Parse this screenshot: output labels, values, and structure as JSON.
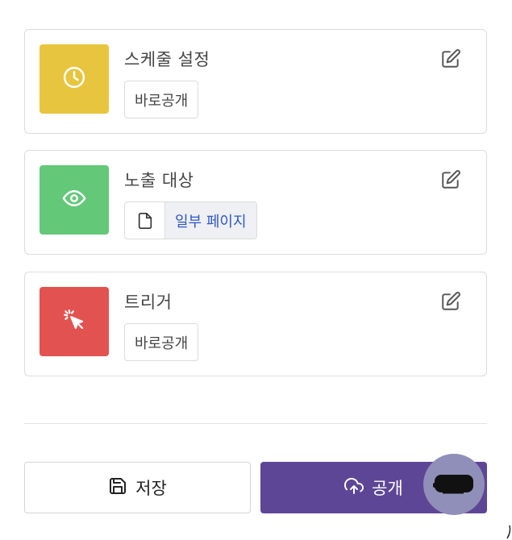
{
  "colors": {
    "schedule_tile": "#e8c53e",
    "exposure_tile": "#63c878",
    "trigger_tile": "#e15250",
    "publish_button": "#5e4696",
    "tag_link_text": "#2f57c7"
  },
  "cards": {
    "schedule": {
      "icon": "clock-icon",
      "title": "스케줄 설정",
      "tag": "바로공개"
    },
    "exposure": {
      "icon": "eye-icon",
      "title": "노출 대상",
      "tag_icon": "document-icon",
      "tag": "일부 페이지"
    },
    "trigger": {
      "icon": "cursor-click-icon",
      "title": "트리거",
      "tag": "바로공개"
    }
  },
  "footer": {
    "save_label": "저장",
    "save_icon": "floppy-disk-icon",
    "publish_label": "공개",
    "publish_icon": "cloud-upload-icon"
  },
  "chat_widget": {
    "icon": "chat-bubble-icon"
  }
}
